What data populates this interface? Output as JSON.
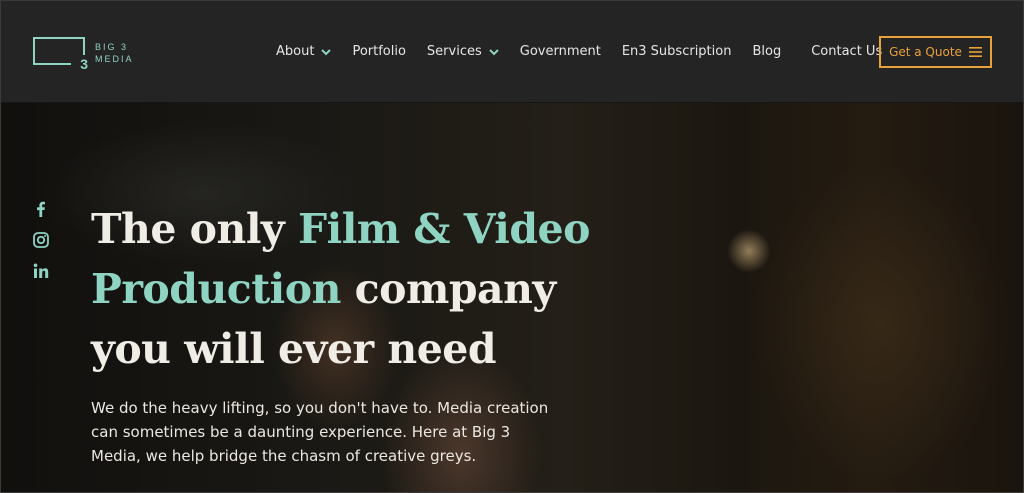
{
  "logo": {
    "mark_number": "3",
    "line1": "BIG 3",
    "line2": "MEDIA"
  },
  "nav": {
    "items": [
      {
        "label": "About",
        "has_dropdown": true
      },
      {
        "label": "Portfolio",
        "has_dropdown": false
      },
      {
        "label": "Services",
        "has_dropdown": true
      },
      {
        "label": "Government",
        "has_dropdown": false
      },
      {
        "label": "En3 Subscription",
        "has_dropdown": false
      },
      {
        "label": "Blog",
        "has_dropdown": false
      },
      {
        "label": "Contact Us",
        "has_dropdown": false
      }
    ],
    "cta_label": "Get a Quote",
    "chevron_icon": "chevron-down-icon",
    "menu_icon": "hamburger-menu-icon"
  },
  "social": [
    {
      "icon": "facebook-icon"
    },
    {
      "icon": "instagram-icon"
    },
    {
      "icon": "linkedin-icon"
    }
  ],
  "hero": {
    "headline_part1": "The only ",
    "headline_accent1": "Film & Video",
    "headline_accent2": "Production",
    "headline_part2": " company",
    "headline_part3": "you will ever need",
    "subtext": "We do the heavy lifting, so you don't have to. Media creation can sometimes be a daunting experience. Here at Big 3 Media, we help bridge the chasm of creative greys."
  },
  "colors": {
    "accent": "#8fd3c3",
    "cta": "#e9a13b",
    "header_bg": "#242424"
  }
}
